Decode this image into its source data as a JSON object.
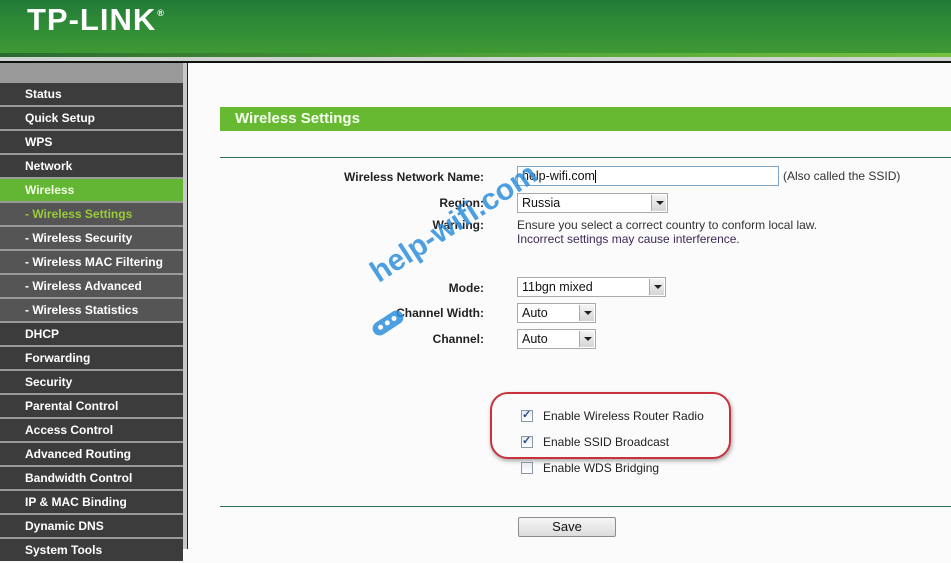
{
  "header": {
    "brand": "TP-LINK",
    "registered_mark": "®"
  },
  "sidebar": {
    "items": [
      {
        "label": "Status",
        "type": "main"
      },
      {
        "label": "Quick Setup",
        "type": "main"
      },
      {
        "label": "WPS",
        "type": "main"
      },
      {
        "label": "Network",
        "type": "main"
      },
      {
        "label": "Wireless",
        "type": "main",
        "active": true
      },
      {
        "label": "- Wireless Settings",
        "type": "sub",
        "active": true
      },
      {
        "label": "- Wireless Security",
        "type": "sub"
      },
      {
        "label": "- Wireless MAC Filtering",
        "type": "sub"
      },
      {
        "label": "- Wireless Advanced",
        "type": "sub"
      },
      {
        "label": "- Wireless Statistics",
        "type": "sub"
      },
      {
        "label": "DHCP",
        "type": "main"
      },
      {
        "label": "Forwarding",
        "type": "main"
      },
      {
        "label": "Security",
        "type": "main"
      },
      {
        "label": "Parental Control",
        "type": "main"
      },
      {
        "label": "Access Control",
        "type": "main"
      },
      {
        "label": "Advanced Routing",
        "type": "main"
      },
      {
        "label": "Bandwidth Control",
        "type": "main"
      },
      {
        "label": "IP & MAC Binding",
        "type": "main"
      },
      {
        "label": "Dynamic DNS",
        "type": "main"
      },
      {
        "label": "System Tools",
        "type": "main"
      }
    ]
  },
  "main": {
    "title": "Wireless Settings",
    "ssid": {
      "label": "Wireless Network Name:",
      "value": "help-wifi.com",
      "hint": "(Also called the SSID)"
    },
    "region": {
      "label": "Region:",
      "value": "Russia"
    },
    "warning": {
      "label": "Warning:",
      "line1": "Ensure you select a correct country to conform local law.",
      "line2": "Incorrect settings may cause interference."
    },
    "mode": {
      "label": "Mode:",
      "value": "11bgn mixed"
    },
    "channel_width": {
      "label": "Channel Width:",
      "value": "Auto"
    },
    "channel": {
      "label": "Channel:",
      "value": "Auto"
    },
    "checkboxes": [
      {
        "label": "Enable Wireless Router Radio",
        "checked": true
      },
      {
        "label": "Enable SSID Broadcast",
        "checked": true
      },
      {
        "label": "Enable WDS Bridging",
        "checked": false
      }
    ],
    "save_label": "Save"
  },
  "watermark": {
    "text": "help-wifi.com"
  },
  "colors": {
    "header_green": "#2e8a36",
    "accent_green": "#66b931",
    "active_sub": "#98cc38",
    "highlight_red": "#c8323a"
  }
}
